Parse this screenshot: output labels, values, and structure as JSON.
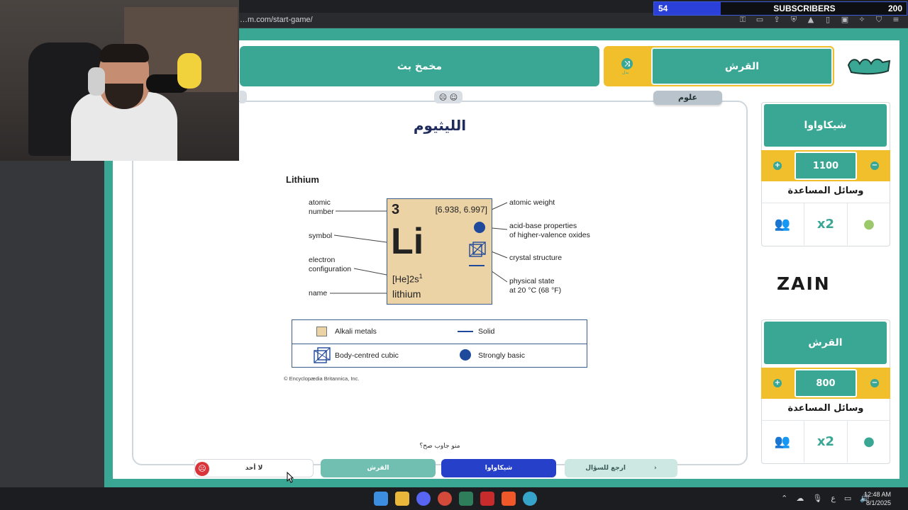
{
  "browser": {
    "url": "…m.com/start-game/"
  },
  "overlay": {
    "subscribers_current": "54",
    "subscribers_label": "SUBSCRIBERS",
    "subscribers_goal": "200"
  },
  "header": {
    "team_left_name": "مخمخ بث",
    "team_right_name": "القرش",
    "swap_label": "بدل"
  },
  "question": {
    "category": "علوم",
    "faces": "☹ ☺",
    "title": "الليثيوم",
    "who_answered": "منو جاوب صح؟"
  },
  "figure": {
    "title": "Lithium",
    "labels": {
      "atomic_number": "atomic\nnumber",
      "symbol": "symbol",
      "electron_configuration": "electron\nconfiguration",
      "name": "name",
      "atomic_weight": "atomic weight",
      "acid_base": "acid-base properties\nof higher-valence oxides",
      "crystal_structure": "crystal structure",
      "physical_state": "physical state\nat 20 °C (68 °F)"
    },
    "card": {
      "number": "3",
      "weight": "[6.938, 6.997]",
      "symbol": "Li",
      "configuration": "[He]2s",
      "configuration_sup": "1",
      "name": "lithium"
    },
    "legend": {
      "alkali": "Alkali metals",
      "solid": "Solid",
      "bcc": "Body-centred cubic",
      "basic": "Strongly basic"
    },
    "copyright": "© Encyclopædia Britannica, Inc."
  },
  "answers": {
    "none": "لا أحد",
    "team_right": "القرش",
    "team_left": "شيكاواوا",
    "back": "ارجع للسؤال"
  },
  "scoreboard": {
    "team1": {
      "name": "شيكاواوا",
      "points": "1100",
      "tools_title": "وسائل المساعدة"
    },
    "team2": {
      "name": "القرش",
      "points": "800",
      "tools_title": "وسائل المساعدة"
    },
    "sponsor": "ZAIN"
  },
  "taskbar": {
    "time": "12:48 AM",
    "date": "8/1/2025",
    "lang": "ع"
  },
  "colors": {
    "teal": "#3aa795",
    "yellow": "#f2bf2c",
    "navy": "#2640c9",
    "card": "#ecd3a6"
  }
}
